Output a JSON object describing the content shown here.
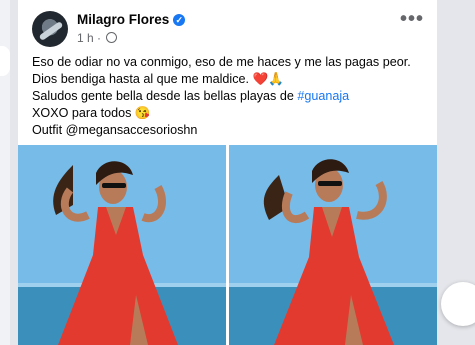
{
  "post": {
    "author": "Milagro Flores",
    "time": "1 h",
    "separator": "·",
    "more_glyph": "•••",
    "caption": [
      {
        "text": "Eso de odiar no va conmigo, eso de me haces y me las pagas peor."
      },
      {
        "text": "Dios bendiga hasta al que me maldice. "
      },
      {
        "text": "Saludos gente bella desde las bellas playas de "
      },
      {
        "text": "XOXO para todos "
      },
      {
        "text": "Outfit @megansaccesorioshn"
      }
    ],
    "hashtag": "#guanaja",
    "emoji_heart": "❤️",
    "emoji_pray": "🙏",
    "emoji_kiss": "😘"
  },
  "photos": [
    {
      "alt_icon": "photo-woman-red-dress-left"
    },
    {
      "alt_icon": "photo-woman-red-dress-right"
    }
  ],
  "colors": {
    "accent": "#1877f2",
    "dress": "#e23a2e",
    "sky": "#6fb6e8",
    "sea": "#3d8fb8"
  }
}
